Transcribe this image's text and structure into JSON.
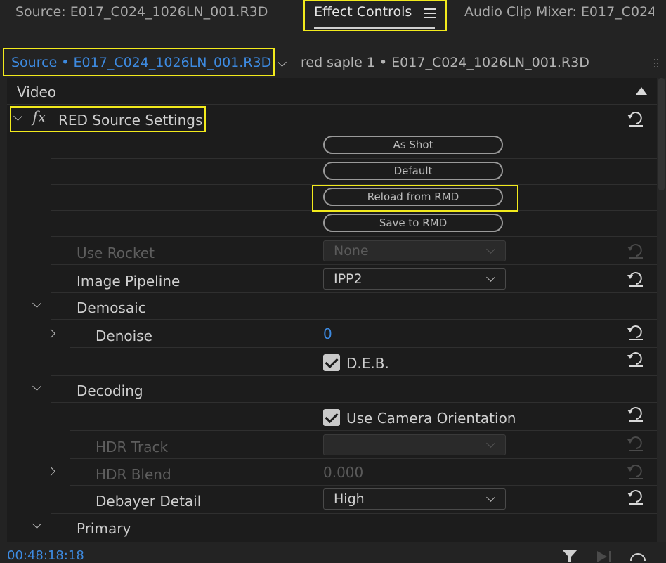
{
  "tabs": [
    {
      "label": "Source: E017_C024_1026LN_001.R3D"
    },
    {
      "label": "Effect Controls"
    },
    {
      "label": "Audio Clip Mixer: E017_C024"
    }
  ],
  "source_bar": {
    "active": "Source • E017_C024_1026LN_001.R3D",
    "sequence": "red saple 1 • E017_C024_1026LN_001.R3D"
  },
  "section": {
    "video": "Video",
    "effect": "RED Source Settings",
    "fx": "fx"
  },
  "buttons": {
    "as_shot": "As Shot",
    "default": "Default",
    "reload": "Reload from RMD",
    "save": "Save to RMD"
  },
  "params": {
    "use_rocket": {
      "label": "Use Rocket",
      "value": "None"
    },
    "image_pipeline": {
      "label": "Image Pipeline",
      "value": "IPP2"
    },
    "demosaic": {
      "label": "Demosaic"
    },
    "denoise": {
      "label": "Denoise",
      "value": "0"
    },
    "deb": {
      "label": "D.E.B."
    },
    "decoding": {
      "label": "Decoding"
    },
    "use_camera_orientation": {
      "label": "Use Camera Orientation"
    },
    "hdr_track": {
      "label": "HDR Track"
    },
    "hdr_blend": {
      "label": "HDR Blend",
      "value": "0.000"
    },
    "debayer_detail": {
      "label": "Debayer Detail",
      "value": "High"
    },
    "primary": {
      "label": "Primary"
    }
  },
  "footer": {
    "timecode": "00:48:18:18"
  },
  "colors": {
    "accent": "#3d8ae0",
    "highlight": "#f2ea1c",
    "panel": "#1c1c1c"
  }
}
